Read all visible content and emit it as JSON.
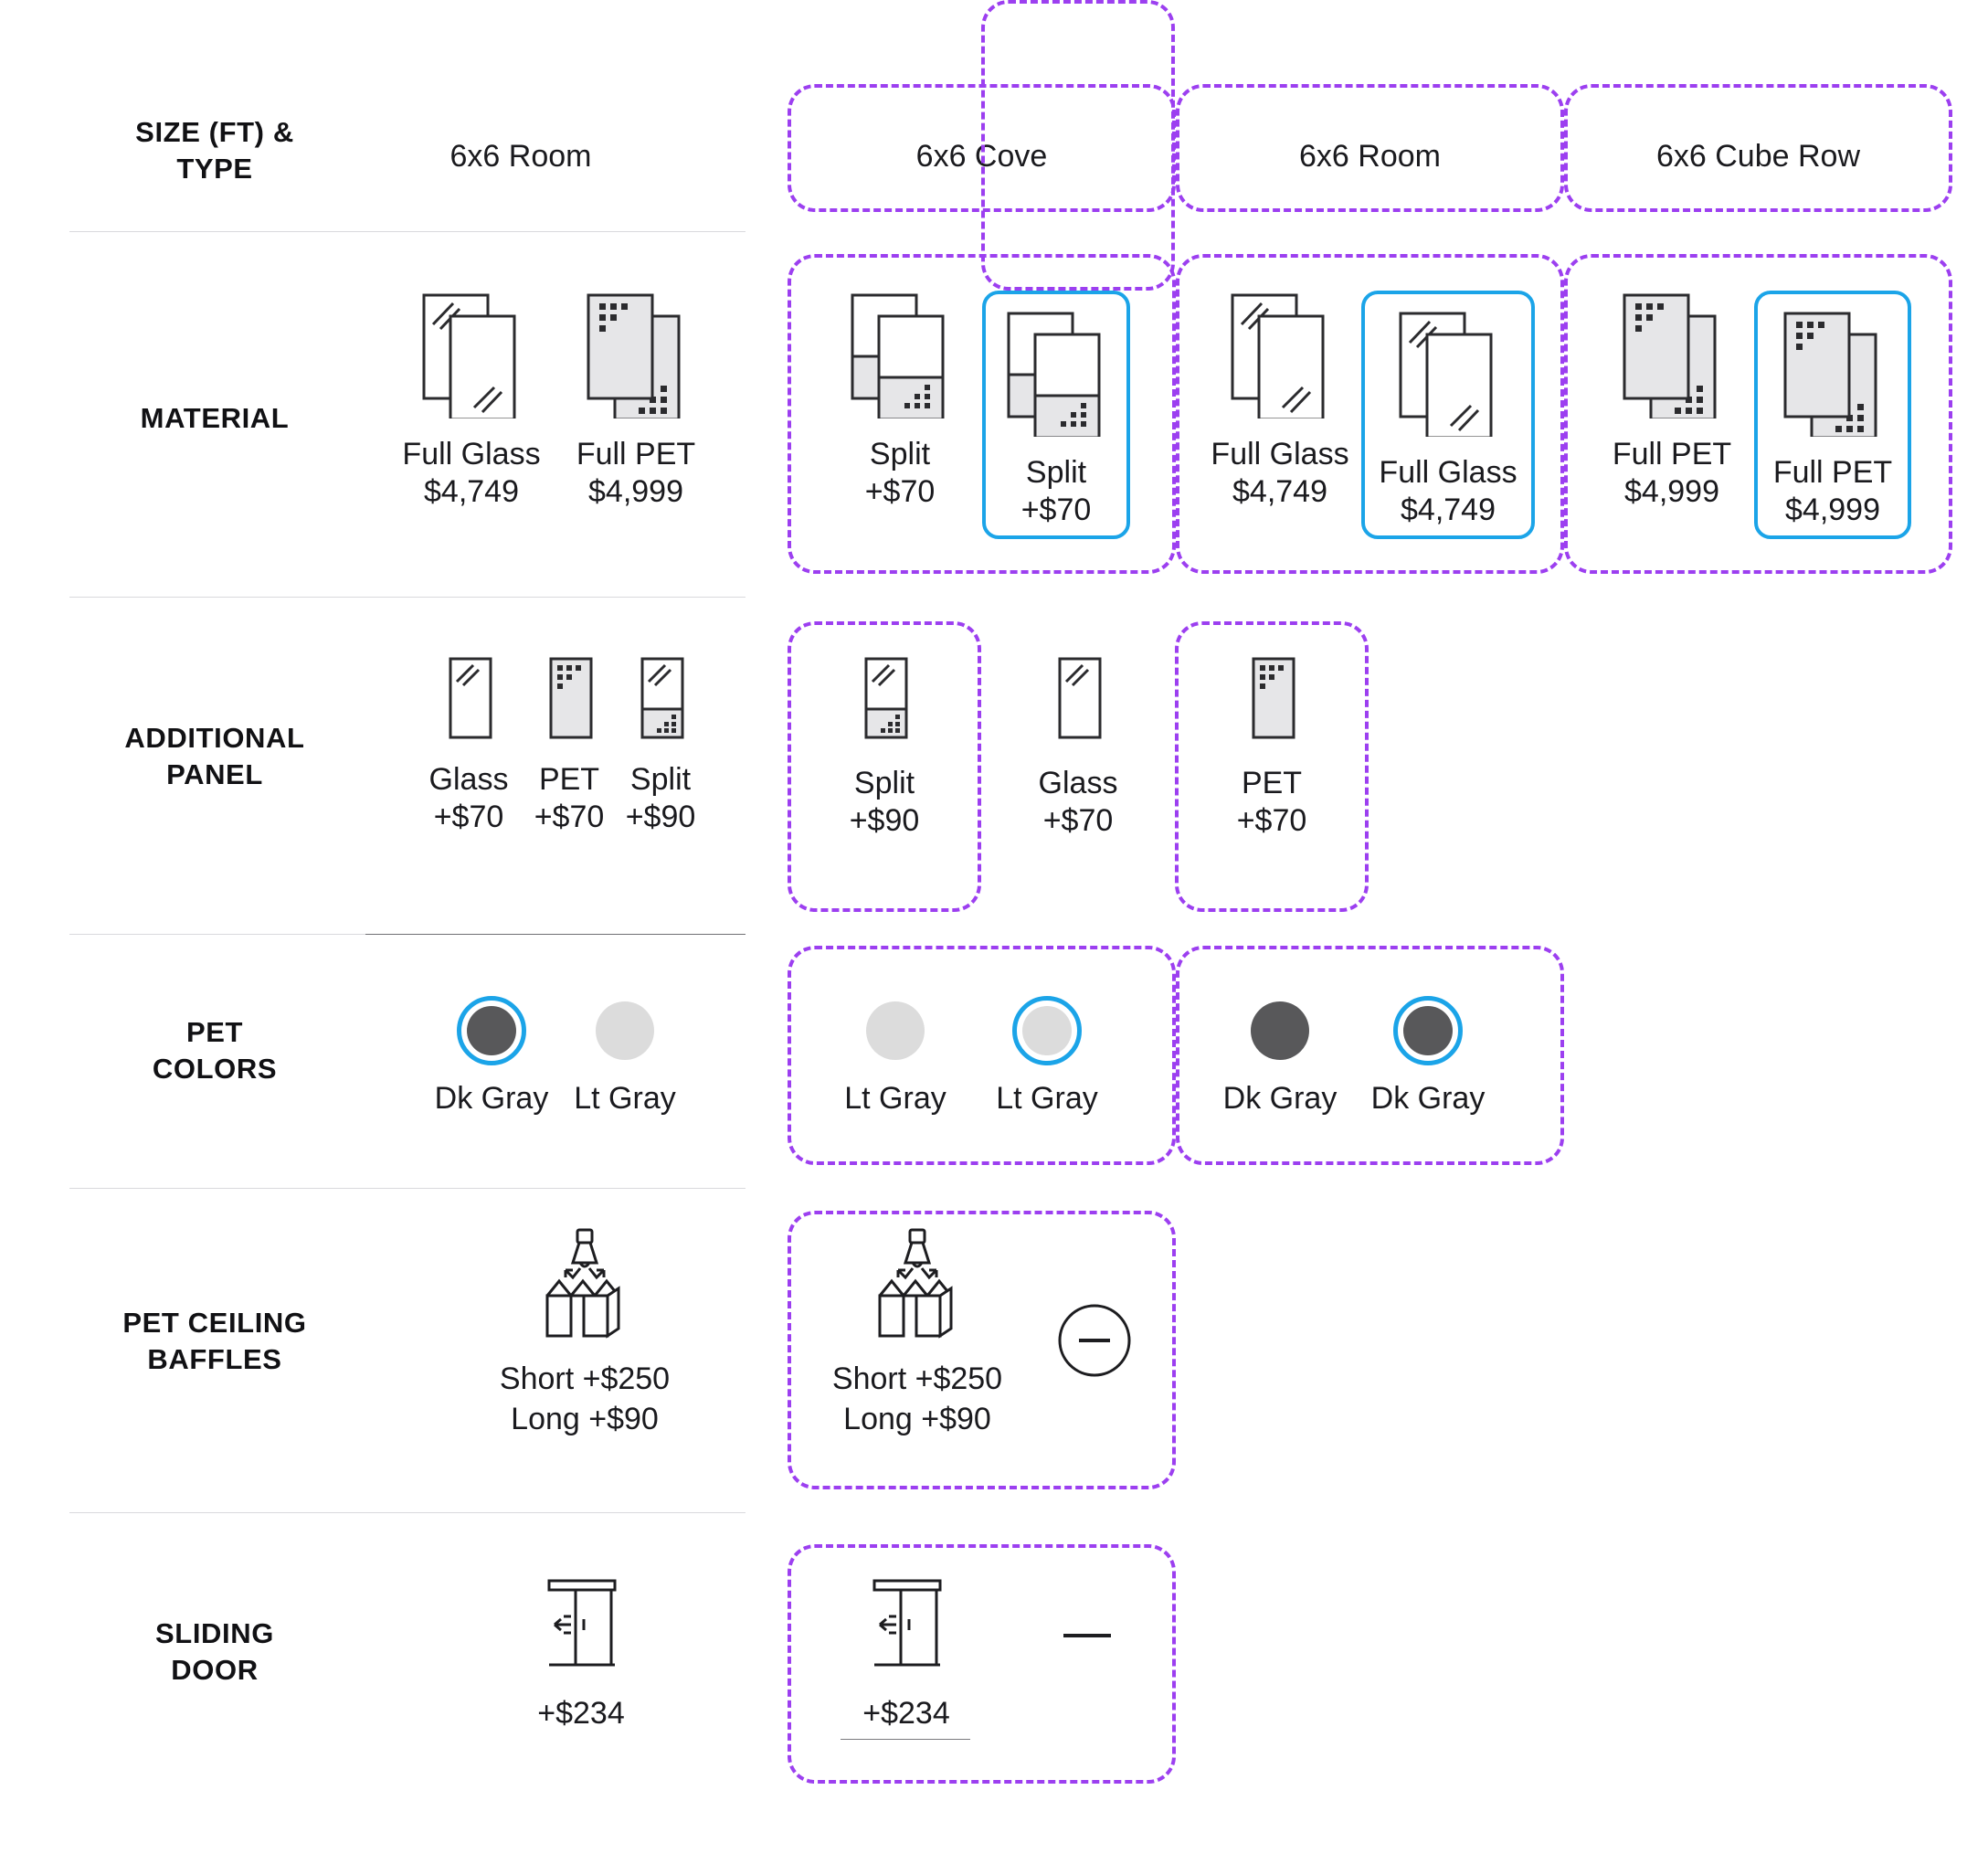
{
  "colors": {
    "purple_group": "#9c3ff0",
    "selected_blue": "#1ba4e8",
    "dk_gray_swatch": "#58585a",
    "lt_gray_swatch": "#dcdcdc",
    "pet_fill": "#e6e6e8",
    "ink": "#1a1a1e",
    "divider": "#d9d9dd"
  },
  "rows": {
    "size_type": {
      "label_line1": "SIZE (FT) &",
      "label_line2": "TYPE"
    },
    "material": {
      "label_line1": "MATERIAL",
      "label_line2": ""
    },
    "additional_panel": {
      "label_line1": "ADDITIONAL",
      "label_line2": "PANEL"
    },
    "pet_colors": {
      "label_line1": "PET",
      "label_line2": "COLORS"
    },
    "pet_ceiling_baffles": {
      "label_line1": "PET CEILING",
      "label_line2": "BAFFLES"
    },
    "sliding_door": {
      "label_line1": "SLIDING",
      "label_line2": "DOOR"
    }
  },
  "reference_column": {
    "size_type": "6x6 Room",
    "material": [
      {
        "label": "Full Glass",
        "price": "$4,749",
        "icon": "double-glass-panel-icon",
        "selected": false
      },
      {
        "label": "Full PET",
        "price": "$4,999",
        "icon": "double-pet-panel-icon",
        "selected": false
      }
    ],
    "additional_panel": [
      {
        "label": "Glass",
        "price": "+$70",
        "icon": "single-glass-panel-icon",
        "selected": false
      },
      {
        "label": "PET",
        "price": "+$70",
        "icon": "single-pet-panel-icon",
        "selected": false
      },
      {
        "label": "Split",
        "price": "+$90",
        "icon": "single-split-panel-icon",
        "selected": false
      }
    ],
    "pet_colors": [
      {
        "label": "Dk Gray",
        "hex": "#58585a",
        "selected": true
      },
      {
        "label": "Lt Gray",
        "hex": "#dcdcdc",
        "selected": false
      }
    ],
    "pet_ceiling_baffles": [
      {
        "icon": "ceiling-baffles-icon",
        "line1": "Short +$250",
        "line2": "Long +$90"
      }
    ],
    "sliding_door": [
      {
        "icon": "sliding-door-icon",
        "price": "+$234"
      }
    ]
  },
  "groups": [
    {
      "name": "6x6 Cove",
      "size_type": "6x6 Cove",
      "material": [
        {
          "label": "Split",
          "price": "+$70",
          "icon": "double-split-panel-icon",
          "selected": false
        },
        {
          "label": "Split",
          "price": "+$70",
          "icon": "double-split-panel-icon",
          "selected": true
        }
      ]
    },
    {
      "name": "6x6 Room",
      "size_type": "6x6 Room",
      "material": [
        {
          "label": "Full Glass",
          "price": "$4,749",
          "icon": "double-glass-panel-icon",
          "selected": false
        },
        {
          "label": "Full Glass",
          "price": "$4,749",
          "icon": "double-glass-panel-icon",
          "selected": true
        }
      ]
    },
    {
      "name": "6x6 Cube Row",
      "size_type": "6x6 Cube Row",
      "material": [
        {
          "label": "Full PET",
          "price": "$4,999",
          "icon": "double-pet-panel-icon",
          "selected": false
        },
        {
          "label": "Full PET",
          "price": "$4,999",
          "icon": "double-pet-panel-icon",
          "selected": true
        }
      ]
    }
  ],
  "additional_panel_groups": [
    {
      "label": "Split",
      "price": "+$90",
      "icon": "single-split-panel-icon"
    },
    {
      "label": "Glass",
      "price": "+$70",
      "icon": "single-glass-panel-icon"
    },
    {
      "label": "PET",
      "price": "+$70",
      "icon": "single-pet-panel-icon"
    }
  ],
  "pet_colors_groups": [
    {
      "swatches": [
        {
          "label": "Lt Gray",
          "hex": "#dcdcdc",
          "selected": false
        },
        {
          "label": "Lt Gray",
          "hex": "#dcdcdc",
          "selected": true
        }
      ]
    },
    {
      "swatches": [
        {
          "label": "Dk Gray",
          "hex": "#58585a",
          "selected": false
        },
        {
          "label": "Dk Gray",
          "hex": "#58585a",
          "selected": true
        }
      ]
    }
  ],
  "pet_ceiling_baffles_group": {
    "baffle": {
      "icon": "ceiling-baffles-icon",
      "line1": "Short +$250",
      "line2": "Long +$90"
    },
    "none": {
      "icon": "minus-circle-icon"
    }
  },
  "sliding_door_group": {
    "door": {
      "icon": "sliding-door-icon",
      "price": "+$234"
    },
    "none": {
      "icon": "dash-icon"
    }
  }
}
